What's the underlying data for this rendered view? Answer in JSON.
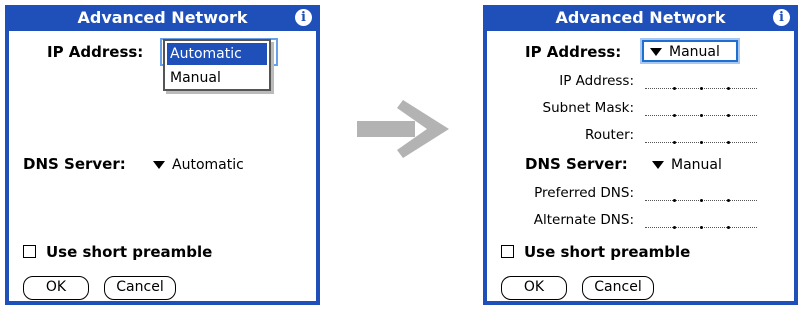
{
  "left": {
    "title": "Advanced Network",
    "ip_address_label": "IP Address:",
    "popup_options": [
      "Automatic",
      "Manual"
    ],
    "popup_selected": "Automatic",
    "dns_server_label": "DNS Server:",
    "dns_server_value": "Automatic",
    "checkbox_label": "Use short preamble",
    "ok_label": "OK",
    "cancel_label": "Cancel"
  },
  "right": {
    "title": "Advanced Network",
    "ip_address_label": "IP Address:",
    "ip_address_value": "Manual",
    "fields": {
      "ip_address": "IP Address:",
      "subnet_mask": "Subnet Mask:",
      "router": "Router:"
    },
    "dns_server_label": "DNS Server:",
    "dns_server_value": "Manual",
    "dns_fields": {
      "preferred": "Preferred DNS:",
      "alternate": "Alternate DNS:"
    },
    "checkbox_label": "Use short preamble",
    "ok_label": "OK",
    "cancel_label": "Cancel"
  },
  "colors": {
    "title_bar": "#1f4fb8",
    "selection": "#1f4fb8",
    "arrow": "#b3b3b3"
  },
  "icons": {
    "info": "info-icon",
    "dropdown": "triangle-down-icon",
    "transition": "right-arrow-icon"
  }
}
